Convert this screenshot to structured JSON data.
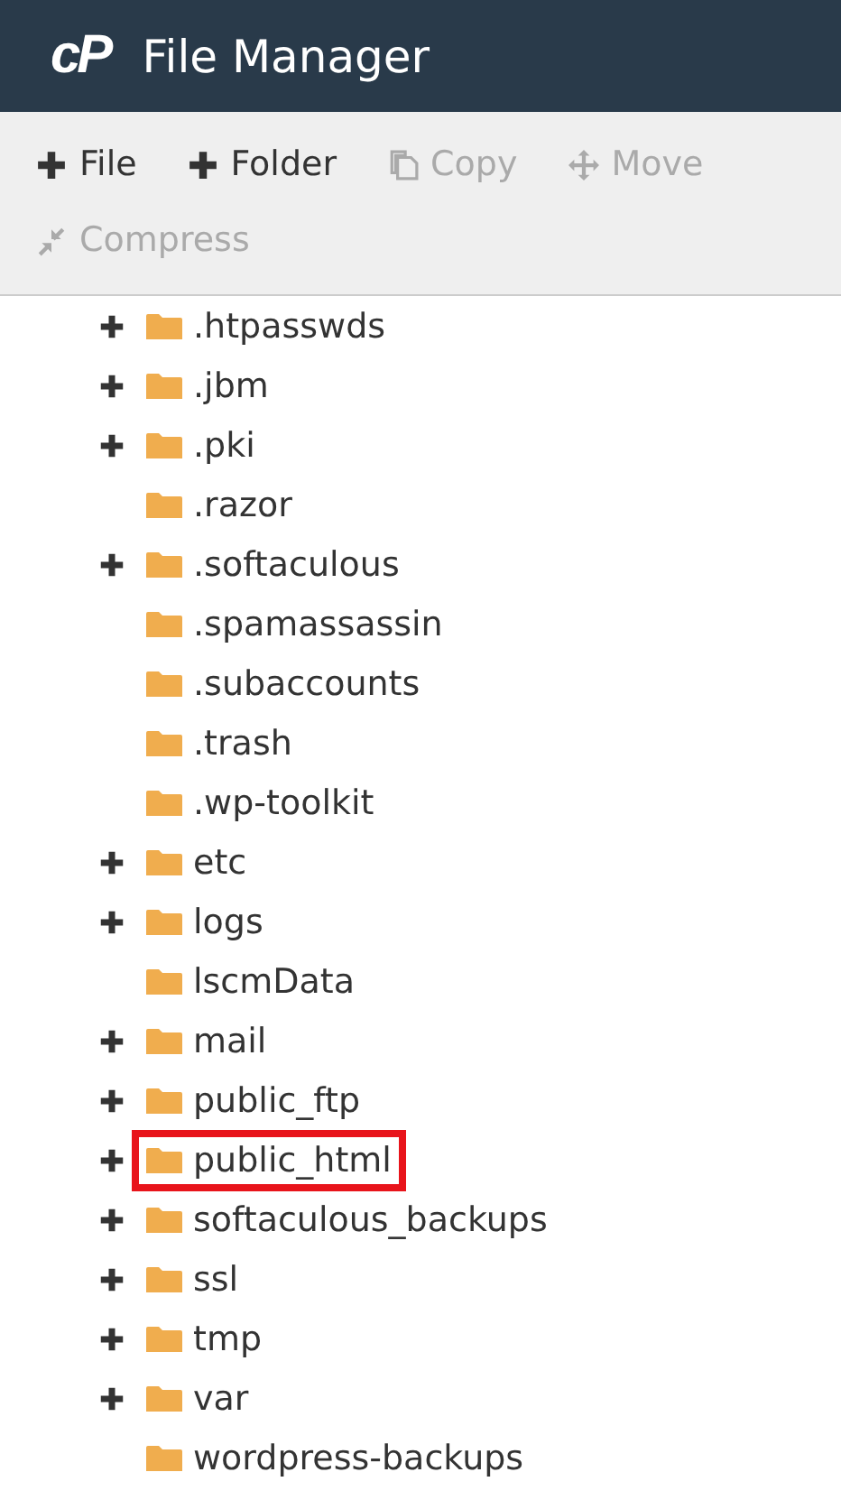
{
  "header": {
    "logo": "cP",
    "title": "File Manager"
  },
  "toolbar": [
    {
      "label": "File",
      "disabled": false
    },
    {
      "label": "Folder",
      "disabled": false
    },
    {
      "label": "Copy",
      "disabled": true
    },
    {
      "label": "Move",
      "disabled": true
    },
    {
      "label": "Compress",
      "disabled": true
    }
  ],
  "tree": [
    {
      "name": ".htpasswds",
      "expandable": true,
      "highlighted": false
    },
    {
      "name": ".jbm",
      "expandable": true,
      "highlighted": false
    },
    {
      "name": ".pki",
      "expandable": true,
      "highlighted": false
    },
    {
      "name": ".razor",
      "expandable": false,
      "highlighted": false
    },
    {
      "name": ".softaculous",
      "expandable": true,
      "highlighted": false
    },
    {
      "name": ".spamassassin",
      "expandable": false,
      "highlighted": false
    },
    {
      "name": ".subaccounts",
      "expandable": false,
      "highlighted": false
    },
    {
      "name": ".trash",
      "expandable": false,
      "highlighted": false
    },
    {
      "name": ".wp-toolkit",
      "expandable": false,
      "highlighted": false
    },
    {
      "name": "etc",
      "expandable": true,
      "highlighted": false
    },
    {
      "name": "logs",
      "expandable": true,
      "highlighted": false
    },
    {
      "name": "lscmData",
      "expandable": false,
      "highlighted": false
    },
    {
      "name": "mail",
      "expandable": true,
      "highlighted": false
    },
    {
      "name": "public_ftp",
      "expandable": true,
      "highlighted": false
    },
    {
      "name": "public_html",
      "expandable": true,
      "highlighted": true
    },
    {
      "name": "softaculous_backups",
      "expandable": true,
      "highlighted": false
    },
    {
      "name": "ssl",
      "expandable": true,
      "highlighted": false
    },
    {
      "name": "tmp",
      "expandable": true,
      "highlighted": false
    },
    {
      "name": "var",
      "expandable": true,
      "highlighted": false
    },
    {
      "name": "wordpress-backups",
      "expandable": false,
      "highlighted": false
    }
  ]
}
